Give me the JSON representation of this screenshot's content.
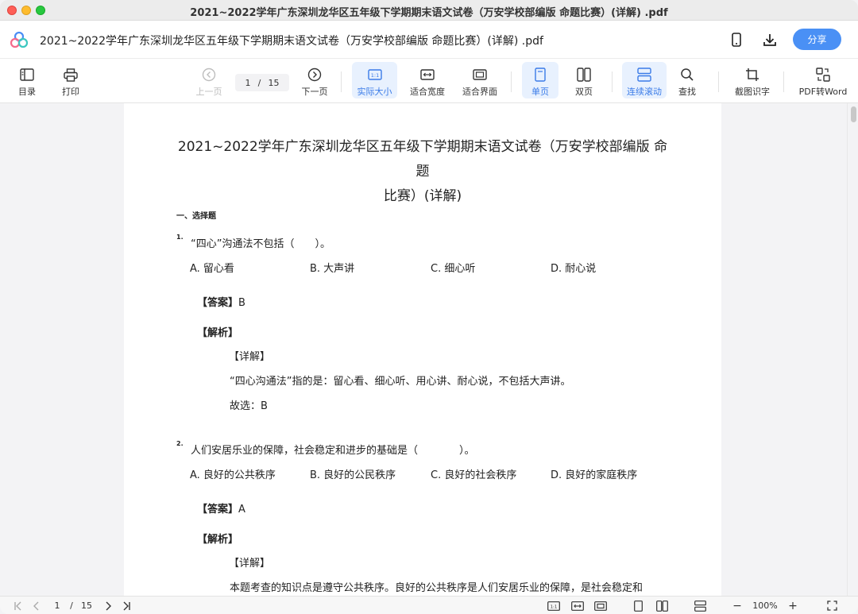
{
  "window": {
    "title": "2021~2022学年广东深圳龙华区五年级下学期期末语文试卷（万安学校部编版 命题比赛）(详解) .pdf"
  },
  "header": {
    "doc_title": "2021~2022学年广东深圳龙华区五年级下学期期末语文试卷（万安学校部编版 命题比赛）(详解) .pdf",
    "share_label": "分享",
    "icons": [
      "app-logo-icon",
      "phone-icon",
      "download-icon"
    ]
  },
  "toolbar": {
    "toc": "目录",
    "print": "打印",
    "prev": "上一页",
    "current_page": "1",
    "slash": "/",
    "total_pages": "15",
    "next": "下一页",
    "actual_size": "实际大小",
    "fit_width": "适合宽度",
    "fit_page": "适合界面",
    "single_page": "单页",
    "double_page": "双页",
    "continuous": "连续滚动",
    "search": "查找",
    "ocr": "截图识字",
    "pdf_to_word": "PDF转Word",
    "accent_color": "#3a7be8"
  },
  "document": {
    "title_line1": "2021~2022学年广东深圳龙华区五年级下学期期末语文试卷（万安学校部编版 命题",
    "title_line2": "比赛）(详解)",
    "section": "一、选择题",
    "q1": {
      "num": "1.",
      "text": "“四心”沟通法不包括（　　）。",
      "options": [
        "A. 留心看",
        "B. 大声讲",
        "C. 细心听",
        "D. 耐心说"
      ],
      "answer_label": "【答案】",
      "answer": "B",
      "analysis_label": "【解析】",
      "detail_label": "【详解】",
      "detail_text": "“四心沟通法”指的是：留心看、细心听、用心讲、耐心说，不包括大声讲。",
      "conclusion": "故选：B"
    },
    "q2": {
      "num": "2.",
      "text": "人们安居乐业的保障，社会稳定和进步的基础是（　　　　）。",
      "options": [
        "A. 良好的公共秩序",
        "B. 良好的公民秩序",
        "C. 良好的社会秩序",
        "D. 良好的家庭秩序"
      ],
      "answer_label": "【答案】",
      "answer": "A",
      "analysis_label": "【解析】",
      "detail_label": "【详解】",
      "detail_text": "本题考查的知识点是遵守公共秩序。良好的公共秩序是人们安居乐业的保障，是社会稳定和"
    }
  },
  "statusbar": {
    "current_page": "1",
    "slash": "/",
    "total_pages": "15",
    "zoom": "100%",
    "minus": "−",
    "plus": "+"
  }
}
